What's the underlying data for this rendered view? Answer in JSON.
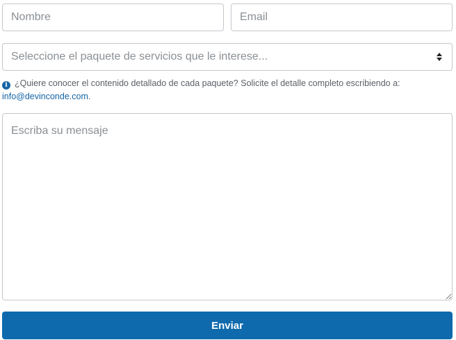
{
  "form": {
    "nombre_placeholder": "Nombre",
    "email_placeholder": "Email",
    "paquete_placeholder": "Seleccione el paquete de servicios que le interese...",
    "hint_text": "¿Quiere conocer el contenido detallado de cada paquete? Solicite el detalle completo escribiendo a:",
    "hint_email": "info@devinconde.com",
    "hint_suffix": ".",
    "mensaje_placeholder": "Escriba su mensaje",
    "submit_label": "Enviar"
  },
  "icons": {
    "info": "info-circle-icon",
    "select_caret": "sort-caret-icon"
  },
  "colors": {
    "primary": "#0e6aad",
    "link": "#1565a7",
    "border": "#c3c7cc",
    "placeholder": "#8a8f94"
  }
}
